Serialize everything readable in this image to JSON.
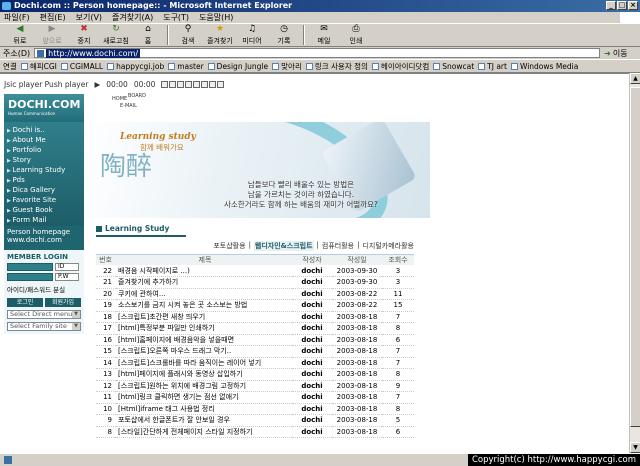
{
  "window": {
    "title": "Dochi.com :: Person homepage:: - Microsoft Internet Explorer",
    "controls": [
      "_",
      "□",
      "×"
    ]
  },
  "menu": [
    "파일(F)",
    "편집(E)",
    "보기(V)",
    "즐겨찾기(A)",
    "도구(T)",
    "도움말(H)"
  ],
  "toolbar": {
    "back": "뒤로",
    "forward": "앞으로",
    "stop": "중지",
    "refresh": "새로고침",
    "home": "홈",
    "search": "검색",
    "favorites": "즐겨찾기",
    "media": "미디어",
    "history": "기록",
    "mail": "메일",
    "print": "인쇄"
  },
  "address": {
    "label": "주소(D)",
    "url": "http://www.dochi.com/",
    "go": "이동"
  },
  "links": {
    "label": "연결",
    "items": [
      "해피CGI",
      "CGIMALL",
      "happycgi.job",
      "master",
      "Design Jungle",
      "맞아리",
      "링크 사용자 정의",
      "헤이아이디닷컴",
      "Snowcat",
      "TJ art",
      "Windows Media"
    ]
  },
  "player": {
    "label": "Jsic player Push player",
    "time1": "00:00",
    "time2": "00:00"
  },
  "site": {
    "logo": "DOCHI.COM",
    "logo_sub": "Human Communication",
    "top_nav": [
      "HOME",
      "BOARD",
      "E-MAIL"
    ],
    "nav": [
      "Dochi is..",
      "About Me",
      "Portfolio",
      "Story",
      "Learning Study",
      "Pds",
      "Dica Gallery",
      "Favorite Site",
      "Guest Book",
      "Form Mail"
    ],
    "home_label": "Person homepage",
    "home_url": "www.dochi.com",
    "login": {
      "title": "MEMBER LOGIN",
      "id_tag": "ID",
      "pw_tag": "P.W",
      "find": "아이디/패스워드 분실",
      "login_btn": "로그인",
      "join_btn": "회원가입"
    },
    "select_direct": "Select Direct menu",
    "select_family": "Select Family site"
  },
  "banner": {
    "title": "Learning study",
    "subtitle": "함께 배워가요",
    "hanja": "陶醉",
    "tagline_1": "남들보다 빨리 배울수 있는 방법은",
    "tagline_2": "남을 가르치는 것이라 하였습니다.",
    "tagline_3": "사소한거라도 함께 하는 배움의 재미가 어떨까요?"
  },
  "board": {
    "title": "Learning Study",
    "categories": [
      "포토샵활용",
      "웹디자인&스크립트",
      "컴퓨터활용",
      "디지털카메라활용"
    ],
    "active_category": "웹디자인&스크립트",
    "headers": {
      "no": "번호",
      "subject": "제목",
      "author": "작성자",
      "date": "작성일",
      "views": "조회수"
    },
    "rows": [
      {
        "no": "22",
        "subject": "배경음 시작페이지로 ...)",
        "author": "dochi",
        "date": "2003-09-30",
        "views": "3"
      },
      {
        "no": "21",
        "subject": "즐겨찾기에 추가하기",
        "author": "dochi",
        "date": "2003-09-30",
        "views": "3"
      },
      {
        "no": "20",
        "subject": "쿠키에 관하여...",
        "author": "dochi",
        "date": "2003-08-22",
        "views": "11"
      },
      {
        "no": "19",
        "subject": "소스보기를 금지 시켜 놓은 곳 소스보는 방법",
        "author": "dochi",
        "date": "2003-08-22",
        "views": "15"
      },
      {
        "no": "18",
        "subject": "[스크립트]초간편 새창 띄우기",
        "author": "dochi",
        "date": "2003-08-18",
        "views": "7"
      },
      {
        "no": "17",
        "subject": "[html]특정부분 파일만 인쇄하기",
        "author": "dochi",
        "date": "2003-08-18",
        "views": "8"
      },
      {
        "no": "16",
        "subject": "[html]홈페이지에 배경음악을 넣을때면",
        "author": "dochi",
        "date": "2003-08-18",
        "views": "6"
      },
      {
        "no": "15",
        "subject": "[스크립트]오른쪽 마우스 드래그 막기..",
        "author": "dochi",
        "date": "2003-08-18",
        "views": "7"
      },
      {
        "no": "14",
        "subject": "[스크립트]스크롤바를 따라 움직이는 레이어 넣기",
        "author": "dochi",
        "date": "2003-08-18",
        "views": "7"
      },
      {
        "no": "13",
        "subject": "[html]페이지에 플래시와 동영상 삽입하기",
        "author": "dochi",
        "date": "2003-08-18",
        "views": "8"
      },
      {
        "no": "12",
        "subject": "[스크립트]원하는 위치에 배경그림 고정하기",
        "author": "dochi",
        "date": "2003-08-18",
        "views": "9"
      },
      {
        "no": "11",
        "subject": "[html]링크 클릭하면 생기는 점선 없애기",
        "author": "dochi",
        "date": "2003-08-18",
        "views": "7"
      },
      {
        "no": "10",
        "subject": "[Html]iframe 태그 사용법 정리",
        "author": "dochi",
        "date": "2003-08-18",
        "views": "8"
      },
      {
        "no": "9",
        "subject": "포토샵에서 한글폰트가 잘 안보일 경우",
        "author": "dochi",
        "date": "2003-08-18",
        "views": "5"
      },
      {
        "no": "8",
        "subject": "[스타일]간단하게 전체페이지 스타일 지정하기",
        "author": "dochi",
        "date": "2003-08-18",
        "views": "6"
      }
    ]
  },
  "status": {
    "copyright": "Copyright(c) http://www.happycgi.com"
  }
}
